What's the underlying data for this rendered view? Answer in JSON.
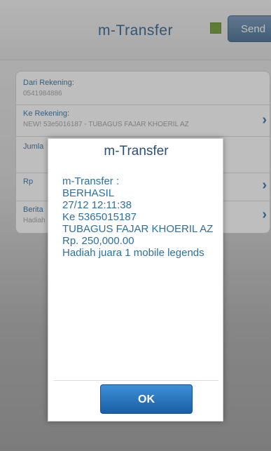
{
  "header": {
    "title": "m-Transfer",
    "send_label": "Send"
  },
  "form": {
    "rows": [
      {
        "label": "Dari Rekening:",
        "value": "0541984886"
      },
      {
        "label": "Ke Rekening:",
        "value": "NEW! 53e5016187 - TUBAGUS FAJAR KHOERIL AZ"
      },
      {
        "label": "Jumla",
        "value": ""
      },
      {
        "label": "Rp",
        "value": ""
      },
      {
        "label": "Berita",
        "value": "Hadiah"
      }
    ]
  },
  "dialog": {
    "title": "m-Transfer",
    "lines": [
      "m-Transfer :",
      "BERHASIL",
      "27/12 12:11:38",
      "Ke 5365015187",
      "TUBAGUS FAJAR KHOERIL AZ",
      "Rp. 250,000.00",
      "Hadiah juara 1 mobile legends"
    ],
    "ok_label": "OK"
  },
  "colors": {
    "accent": "#2d6f9c",
    "ok_button": "#1a5fa6",
    "status_square": "#6e9a2e"
  }
}
